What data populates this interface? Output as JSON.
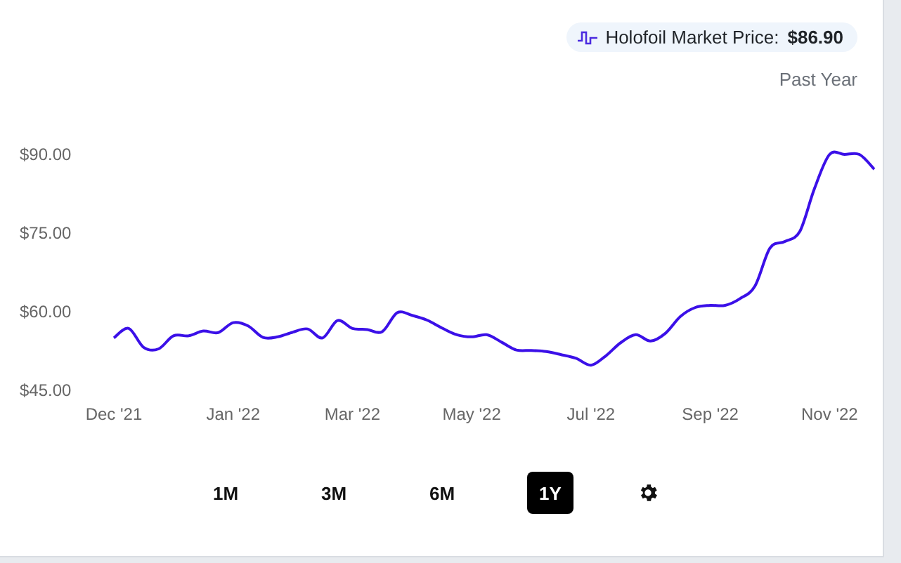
{
  "price_badge": {
    "label": "Holofoil Market Price:",
    "value": "$86.90"
  },
  "period_label": "Past Year",
  "chart_data": {
    "type": "line",
    "yticks": [
      {
        "value": 45,
        "label": "$45.00"
      },
      {
        "value": 60,
        "label": "$60.00"
      },
      {
        "value": 75,
        "label": "$75.00"
      },
      {
        "value": 90,
        "label": "$90.00"
      }
    ],
    "ylim": [
      45,
      90
    ],
    "categories": [
      "Dec '21",
      null,
      null,
      null,
      null,
      null,
      null,
      null,
      "Jan '22",
      null,
      null,
      null,
      null,
      null,
      null,
      null,
      "Mar '22",
      null,
      null,
      null,
      null,
      null,
      null,
      null,
      "May '22",
      null,
      null,
      null,
      null,
      null,
      null,
      null,
      "Jul '22",
      null,
      null,
      null,
      null,
      null,
      null,
      null,
      "Sep '22",
      null,
      null,
      null,
      null,
      null,
      null,
      null,
      "Nov '22",
      null,
      null,
      null
    ],
    "series": [
      {
        "color": "#3b10e8",
        "values": [
          55.0,
          56.8,
          53.2,
          52.9,
          55.4,
          55.4,
          56.3,
          56.0,
          57.9,
          57.3,
          55.1,
          55.2,
          56.1,
          56.7,
          55.0,
          58.3,
          56.8,
          56.6,
          56.2,
          59.8,
          59.3,
          58.4,
          56.9,
          55.6,
          55.2,
          55.6,
          54.2,
          52.7,
          52.6,
          52.4,
          51.8,
          51.1,
          49.8,
          51.6,
          54.1,
          55.6,
          54.4,
          55.9,
          59.1,
          60.8,
          61.2,
          61.2,
          62.5,
          64.9,
          72.1,
          73.4,
          75.3,
          83.6,
          90.0,
          90.0,
          90.0,
          87.2
        ]
      }
    ]
  },
  "ranges": [
    {
      "label": "1M",
      "selected": false
    },
    {
      "label": "3M",
      "selected": false
    },
    {
      "label": "6M",
      "selected": false
    },
    {
      "label": "1Y",
      "selected": true
    }
  ]
}
